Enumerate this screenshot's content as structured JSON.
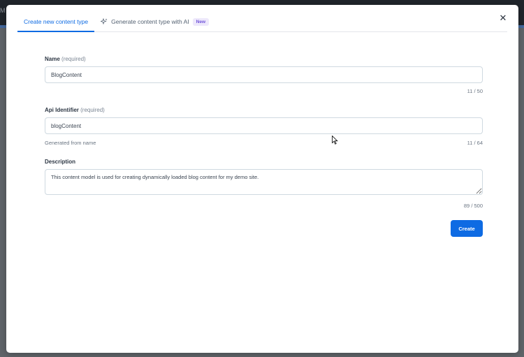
{
  "background": {
    "app_text": "M"
  },
  "modal": {
    "tabs": [
      {
        "label": "Create new content type",
        "active": true
      },
      {
        "label": "Generate content type with AI",
        "icon": "sparkle-icon",
        "badge": "New"
      }
    ],
    "close_icon": "close-icon"
  },
  "form": {
    "name": {
      "label": "Name",
      "required_text": "(required)",
      "value": "BlogContent",
      "counter": "11 / 50"
    },
    "api_identifier": {
      "label": "Api Identifier",
      "required_text": "(required)",
      "value": "blogContent",
      "hint": "Generated from name",
      "counter": "11 / 64"
    },
    "description": {
      "label": "Description",
      "value": "This content model is used for creating dynamically loaded blog content for my demo site.",
      "counter": "89 / 500"
    },
    "create_label": "Create"
  },
  "colors": {
    "accent": "#0e6be3",
    "badge_bg": "#ede8fb",
    "badge_text": "#6f52d9"
  }
}
